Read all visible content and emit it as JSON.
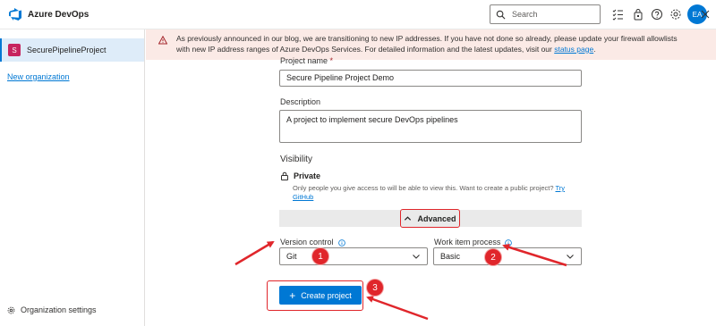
{
  "header": {
    "brand": "Azure DevOps",
    "search_placeholder": "Search",
    "avatar_initials": "EA",
    "icons": [
      "search-icon",
      "task-list-icon",
      "shopping-bag-icon",
      "help-icon",
      "settings-icon"
    ]
  },
  "sidebar": {
    "project_initial": "S",
    "project_name": "SecurePipelineProject",
    "new_org_link": "New organization",
    "org_settings": "Organization settings"
  },
  "banner": {
    "text": "As previously announced in our blog, we are transitioning to new IP addresses. If you have not done so already, please update your firewall allowlists with new IP address ranges of Azure DevOps Services. For detailed information and the latest updates, visit our ",
    "link": "status page",
    "after_link": "."
  },
  "form": {
    "project_name_label": "Project name",
    "required_mark": "*",
    "project_name_value": "Secure Pipeline Project Demo",
    "description_label": "Description",
    "description_value": "A project to implement secure DevOps pipelines",
    "visibility_label": "Visibility",
    "visibility_value": "Private",
    "visibility_desc": "Only people you give access to will be able to view this. Want to create a public project? ",
    "visibility_link": "Try GitHub",
    "advanced_label": "Advanced",
    "version_control_label": "Version control",
    "version_control_value": "Git",
    "work_item_label": "Work item process",
    "work_item_value": "Basic",
    "create_button": "Create project"
  },
  "annotations": {
    "steps": [
      "1",
      "2",
      "3"
    ],
    "highlight_color": "#e0262b"
  },
  "colors": {
    "accent": "#0078d4",
    "banner_bg": "#fbeae6",
    "project_badge": "#c7245e"
  }
}
